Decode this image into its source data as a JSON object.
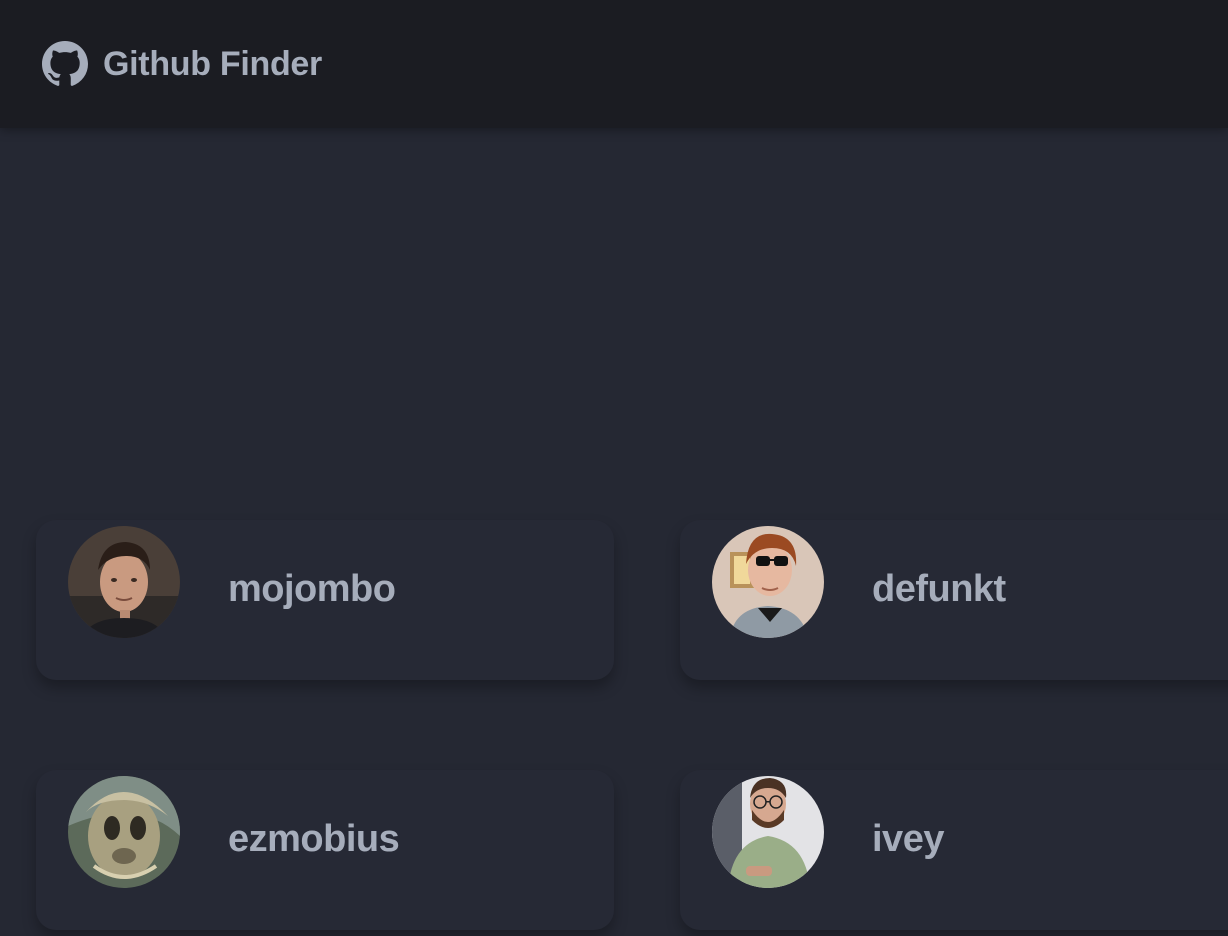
{
  "navbar": {
    "title": "Github Finder",
    "logo_icon": "github-icon"
  },
  "users": [
    {
      "login": "mojombo",
      "avatar_icon": "avatar-photo"
    },
    {
      "login": "defunkt",
      "avatar_icon": "avatar-photo"
    },
    {
      "login": "ezmobius",
      "avatar_icon": "avatar-photo"
    },
    {
      "login": "ivey",
      "avatar_icon": "avatar-photo"
    }
  ],
  "colors": {
    "navbar_bg": "#1b1c22",
    "page_bg": "#252833",
    "text": "#a6adbb"
  }
}
